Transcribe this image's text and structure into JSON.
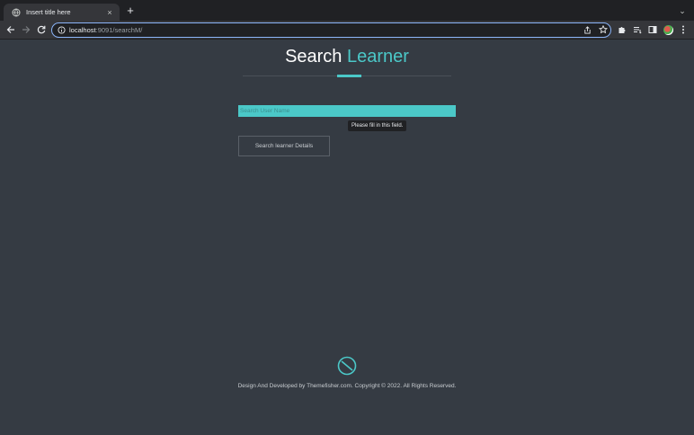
{
  "browser": {
    "tab_title": "Insert title here",
    "tab_close": "×",
    "new_tab": "+",
    "tab_menu": "⌄",
    "url_host": "localhost",
    "url_path": ":9091/searchM/"
  },
  "page": {
    "heading_main": "Search",
    "heading_accent": "Learner",
    "accent_color": "#4bc8c8",
    "search_placeholder": "Search User Name",
    "validation_tooltip": "Please fill in this field.",
    "search_button_label": "Search learner Details"
  },
  "footer": {
    "logo_icon": "compass-icon",
    "text": "Design And Developed by Themefisher.com. Copyright © 2022. All Rights Reserved."
  }
}
